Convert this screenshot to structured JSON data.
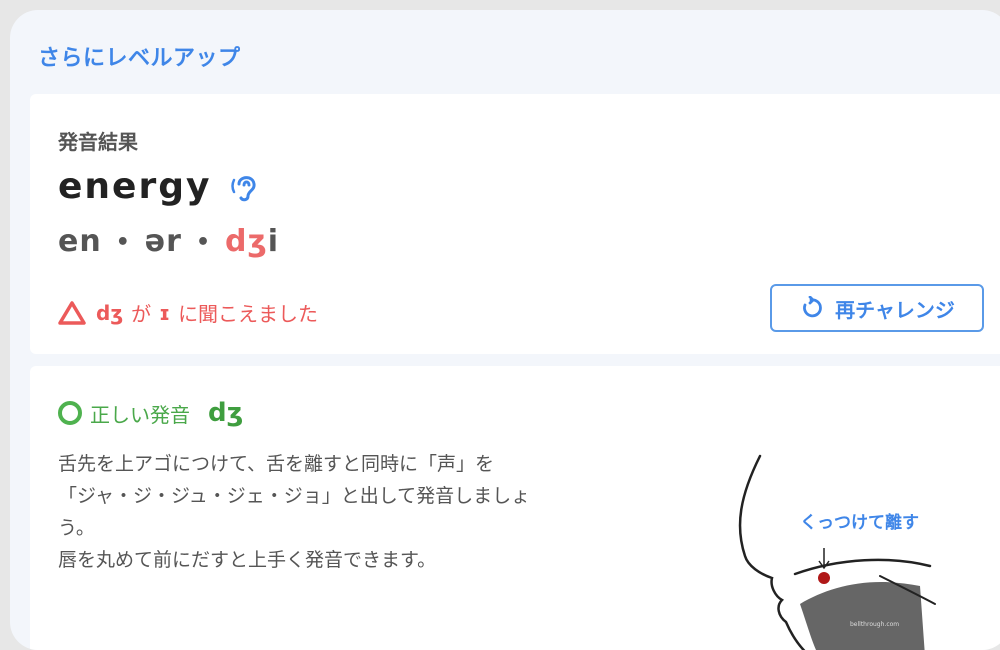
{
  "section": {
    "title": "さらにレベルアップ"
  },
  "result": {
    "label": "発音結果",
    "word": "energy",
    "ipa": {
      "part1": "en",
      "sep1": "•",
      "part2": "ər",
      "sep2": "•",
      "part3_hl": "dʒ",
      "part3_rest": "i"
    },
    "warning": {
      "symbol": "dʒ",
      "text_ga": "が",
      "heard_symbol": "ɪ",
      "text_rest": "に聞こえました"
    },
    "retry_label": "再チャレンジ"
  },
  "correct": {
    "label": "正しい発音",
    "symbol": "dʒ",
    "description": [
      "舌先を上アゴにつけて、舌を離すと同時に「声」を",
      "「ジャ・ジ・ジュ・ジェ・ジョ」と出して発音しましょ",
      "う。",
      "唇を丸めて前にだすと上手く発音できます。"
    ],
    "illustration_caption": "くっつけて離す",
    "illustration_credit": "bellthrough.com"
  },
  "colors": {
    "accent": "#3f86e8",
    "warning": "#ec5a5a",
    "success": "#4fb24f"
  },
  "icons": [
    "ear-icon",
    "warning-triangle-icon",
    "retry-icon",
    "correct-circle-icon"
  ]
}
